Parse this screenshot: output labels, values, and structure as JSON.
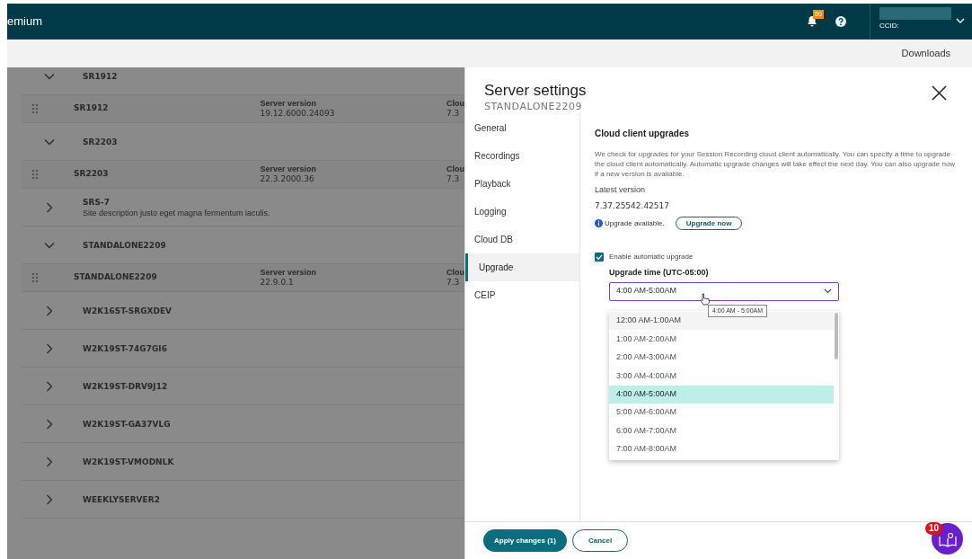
{
  "top_bar": {
    "title": "emium",
    "notification_count": "50",
    "account_label": "CCID:"
  },
  "sub_bar": {
    "link": "Downloads"
  },
  "server_list": [
    {
      "kind": "group",
      "expanded": true,
      "name": "SR1912"
    },
    {
      "kind": "server",
      "name": "SR1912",
      "version_label": "Server version",
      "version": "19.12.6000.24093",
      "column_3_label": "Clou",
      "column_3_value": "7.3"
    },
    {
      "kind": "group",
      "expanded": true,
      "name": "SR2203"
    },
    {
      "kind": "server",
      "name": "SR2203",
      "version_label": "Server version",
      "version": "22.3.2000.36",
      "column_3_label": "Clou",
      "column_3_value": "7.3"
    },
    {
      "kind": "group",
      "expanded": false,
      "name": "SRS-7",
      "description": "Site description justo eget magna fermentum iaculis."
    },
    {
      "kind": "group",
      "expanded": true,
      "name": "STANDALONE2209"
    },
    {
      "kind": "server",
      "name": "STANDALONE2209",
      "version_label": "Server version",
      "version": "22.9.0.1",
      "column_3_label": "Clou",
      "column_3_value": "7.3"
    },
    {
      "kind": "group",
      "expanded": false,
      "name": "W2K16ST-SRGXDEV"
    },
    {
      "kind": "group",
      "expanded": false,
      "name": "W2K19ST-74G7GI6"
    },
    {
      "kind": "group",
      "expanded": false,
      "name": "W2K19ST-DRV9J12"
    },
    {
      "kind": "group",
      "expanded": false,
      "name": "W2K19ST-GA37VLG"
    },
    {
      "kind": "group",
      "expanded": false,
      "name": "W2K19ST-VMODNLK"
    },
    {
      "kind": "group",
      "expanded": false,
      "name": "WEEKLYSERVER2"
    }
  ],
  "drawer": {
    "title": "Server settings",
    "subtitle": "STANDALONE2209",
    "nav": [
      {
        "label": "General",
        "selected": false
      },
      {
        "label": "Recordings",
        "selected": false
      },
      {
        "label": "Playback",
        "selected": false
      },
      {
        "label": "Logging",
        "selected": false
      },
      {
        "label": "Cloud DB",
        "selected": false
      },
      {
        "label": "Upgrade",
        "selected": true
      },
      {
        "label": "CEIP",
        "selected": false
      }
    ],
    "section_title": "Cloud client upgrades",
    "description": "We check for upgrades for your Session Recording cloud client automatically. You can specify a time to upgrade the cloud client automatically. Automatic upgrade changes will take effect the next day. You can also upgrade now if a new version is available.",
    "latest_version_label": "Latest version",
    "latest_version": "7.37.25542.42517",
    "upgrade_status": "Upgrade available.",
    "upgrade_button": "Upgrade now",
    "auto_upgrade": {
      "label": "Enable automatic upgrade",
      "checked": true
    },
    "time_select": {
      "label": "Upgrade time (UTC-05:00)",
      "value": "4:00 AM-5:00AM",
      "tooltip": "4:00 AM - 5:00AM",
      "options": [
        {
          "label": "12:00 AM-1:00AM",
          "selected": false,
          "hovered": true
        },
        {
          "label": "1:00 AM-2:00AM",
          "selected": false,
          "hovered": false
        },
        {
          "label": "2:00 AM-3:00AM",
          "selected": false,
          "hovered": false
        },
        {
          "label": "3:00 AM-4:00AM",
          "selected": false,
          "hovered": false
        },
        {
          "label": "4:00 AM-5:00AM",
          "selected": true,
          "hovered": false
        },
        {
          "label": "5:00 AM-6:00AM",
          "selected": false,
          "hovered": false
        },
        {
          "label": "6:00 AM-7:00AM",
          "selected": false,
          "hovered": false
        },
        {
          "label": "7:00 AM-8:00AM",
          "selected": false,
          "hovered": false
        }
      ]
    },
    "apply_button": "Apply changes (1)",
    "cancel_button": "Cancel"
  },
  "help_badge": "10"
}
